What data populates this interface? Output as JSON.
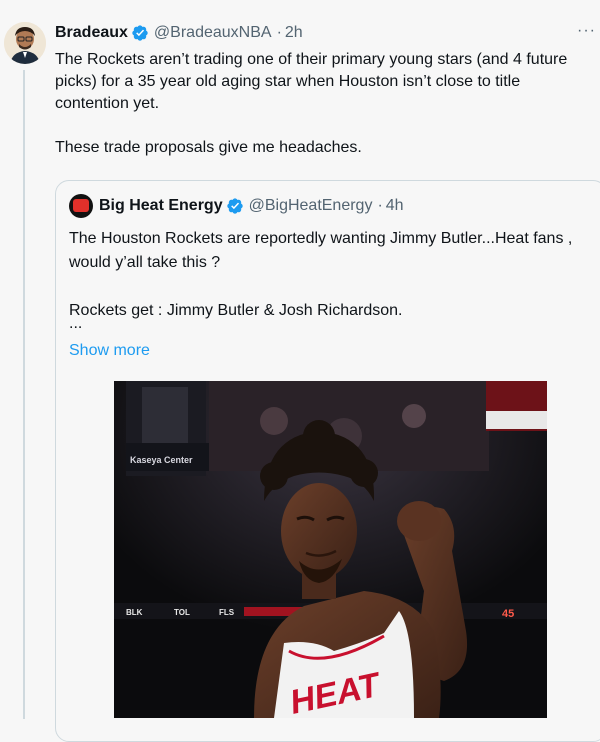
{
  "tweet": {
    "author_name": "Bradeaux",
    "author_handle": "@BradeauxNBA",
    "time": "2h",
    "paragraph1": "The Rockets aren’t trading one of their primary young stars (and 4 future picks) for a 35 year old aging star when Houston isn’t close to title contention yet.",
    "paragraph2": "These trade proposals give me headaches.",
    "more_icon": "···"
  },
  "quote": {
    "author_name": "Big Heat Energy",
    "author_handle": "@BigHeatEnergy",
    "time": "4h",
    "paragraph1": "The Houston Rockets are reportedly wanting Jimmy Butler...Heat fans , would y’all take this ?",
    "paragraph2": "Rockets get : Jimmy Butler & Josh Richardson.",
    "ellipsis": "...",
    "show_more": "Show more"
  },
  "photo": {
    "arena_text": "Kaseya Center",
    "jersey_text": "HEAT",
    "scoreboard": [
      "BLK",
      "TOL",
      "FLS",
      "45"
    ]
  },
  "colors": {
    "link": "#1d9bf0",
    "verified": "#1d9bf0",
    "secondary_text": "#536471",
    "heat_red": "#c8102e"
  }
}
